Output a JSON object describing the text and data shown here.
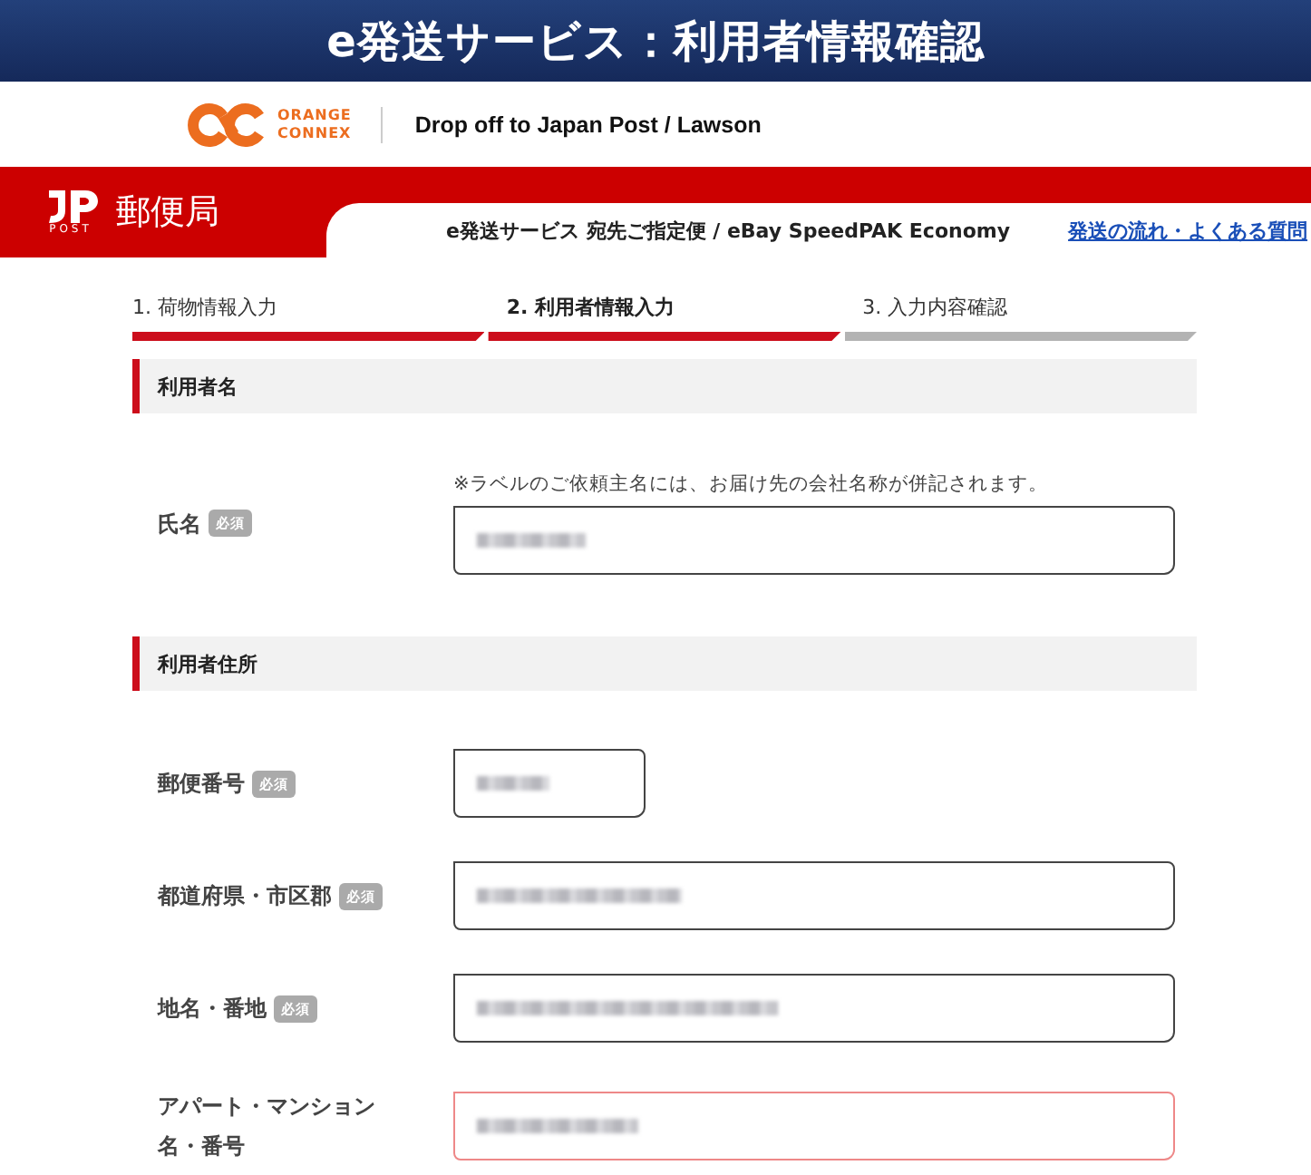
{
  "banner": {
    "title": "e発送サービス：利用者情報確認"
  },
  "header": {
    "logo_line_1": "ORANGE",
    "logo_line_2": "CONNEX",
    "tagline": "Drop off to Japan Post / Lawson"
  },
  "post_bar": {
    "logo_text": "POST",
    "name": "郵便局",
    "service": "e発送サービス 宛先ご指定便 / eBay SpeedPAK Economy",
    "help_link": "発送の流れ・よくある質問"
  },
  "steps": [
    {
      "label": "1. 荷物情報入力",
      "selected": false
    },
    {
      "label": "2. 利用者情報入力",
      "selected": true
    },
    {
      "label": "3. 入力内容確認",
      "selected": false
    }
  ],
  "sections": [
    {
      "title": "利用者名",
      "fields": [
        {
          "label": "氏名",
          "required_badge": "必須",
          "note": "※ラベルのご依頼主名には、お届け先の会社名称が併記されます。",
          "kind": "full",
          "invalid": false
        }
      ]
    },
    {
      "title": "利用者住所",
      "fields": [
        {
          "label": "郵便番号",
          "required_badge": "必須",
          "kind": "short",
          "invalid": false
        },
        {
          "label": "都道府県・市区郡",
          "required_badge": "必須",
          "kind": "full",
          "invalid": false
        },
        {
          "label": "地名・番地",
          "required_badge": "必須",
          "kind": "full",
          "invalid": false
        },
        {
          "label": "アパート・マンション名・番号",
          "kind": "full",
          "invalid": true
        }
      ]
    }
  ]
}
